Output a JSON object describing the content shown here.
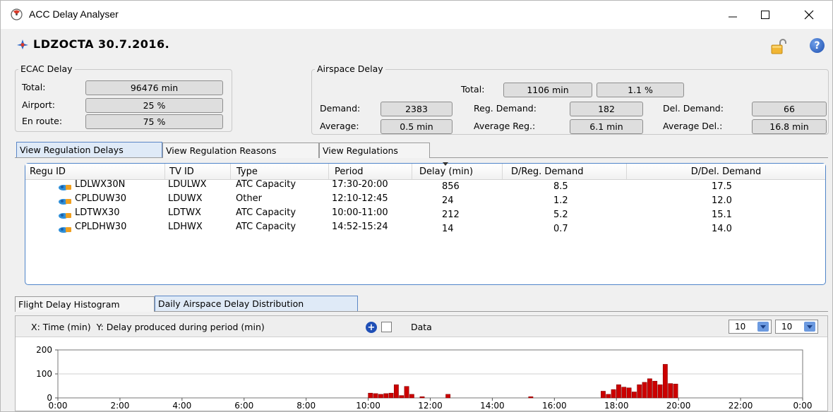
{
  "window": {
    "title": "ACC Delay Analyser"
  },
  "header": {
    "title": "LDZOCTA 30.7.2016."
  },
  "ecac": {
    "title": "ECAC Delay",
    "total_label": "Total:",
    "total_value": "96476 min",
    "airport_label": "Airport:",
    "airport_value": "25 %",
    "enroute_label": "En route:",
    "enroute_value": "75 %"
  },
  "airspace": {
    "title": "Airspace Delay",
    "total_label": "Total:",
    "total_value": "1106 min",
    "total_pct": "1.1 %",
    "demand_label": "Demand:",
    "demand_value": "2383",
    "reg_demand_label": "Reg. Demand:",
    "reg_demand_value": "182",
    "del_demand_label": "Del. Demand:",
    "del_demand_value": "66",
    "average_label": "Average:",
    "average_value": "0.5 min",
    "average_reg_label": "Average Reg.:",
    "average_reg_value": "6.1 min",
    "average_del_label": "Average Del.:",
    "average_del_value": "16.8 min"
  },
  "tabs": [
    {
      "label": "View Regulation Delays"
    },
    {
      "label": "View Regulation Reasons"
    },
    {
      "label": "View Regulations"
    }
  ],
  "table": {
    "columns": [
      "Regu ID",
      "TV ID",
      "Type",
      "Period",
      "Delay (min)",
      "D/Reg. Demand",
      "D/Del. Demand"
    ],
    "rows": [
      [
        "LDLWX30N",
        "LDULWX",
        "ATC Capacity",
        "17:30-20:00",
        "856",
        "8.5",
        "17.5"
      ],
      [
        "CPLDUW30",
        "LDUWX",
        "Other",
        "12:10-12:45",
        "24",
        "1.2",
        "12.0"
      ],
      [
        "LDTWX30",
        "LDTWX",
        "ATC Capacity",
        "10:00-11:00",
        "212",
        "5.2",
        "15.1"
      ],
      [
        "CPLDHW30",
        "LDHWX",
        "ATC Capacity",
        "14:52-15:24",
        "14",
        "0.7",
        "14.0"
      ]
    ]
  },
  "bottom_tabs": [
    {
      "label": "Flight Delay Histogram"
    },
    {
      "label": "Daily Airspace Delay Distribution"
    }
  ],
  "chart_toolbar": {
    "axes_text": "X: Time (min)  Y: Delay produced during period (min)",
    "data_label": "Data",
    "spin1": "10",
    "spin2": "10"
  },
  "chart_data": {
    "type": "bar",
    "xlabel": "Time (min)",
    "ylabel": "Delay produced during period (min)",
    "xlim": [
      0,
      1440
    ],
    "ylim": [
      0,
      200
    ],
    "xticks": [
      "0:00",
      "2:00",
      "4:00",
      "6:00",
      "8:00",
      "10:00",
      "12:00",
      "14:00",
      "16:00",
      "18:00",
      "20:00",
      "22:00",
      "0:00"
    ],
    "yticks": [
      "0",
      "100",
      "200"
    ],
    "bin_width": 10,
    "bar_color": "#cc0000",
    "x": [
      600,
      610,
      620,
      630,
      640,
      650,
      660,
      670,
      680,
      700,
      750,
      910,
      1050,
      1060,
      1070,
      1080,
      1090,
      1100,
      1110,
      1120,
      1130,
      1140,
      1150,
      1160,
      1170,
      1180,
      1190
    ],
    "values": [
      20,
      18,
      15,
      18,
      20,
      55,
      10,
      48,
      15,
      5,
      15,
      5,
      28,
      15,
      35,
      55,
      45,
      42,
      25,
      55,
      65,
      80,
      70,
      55,
      140,
      60,
      58
    ]
  }
}
